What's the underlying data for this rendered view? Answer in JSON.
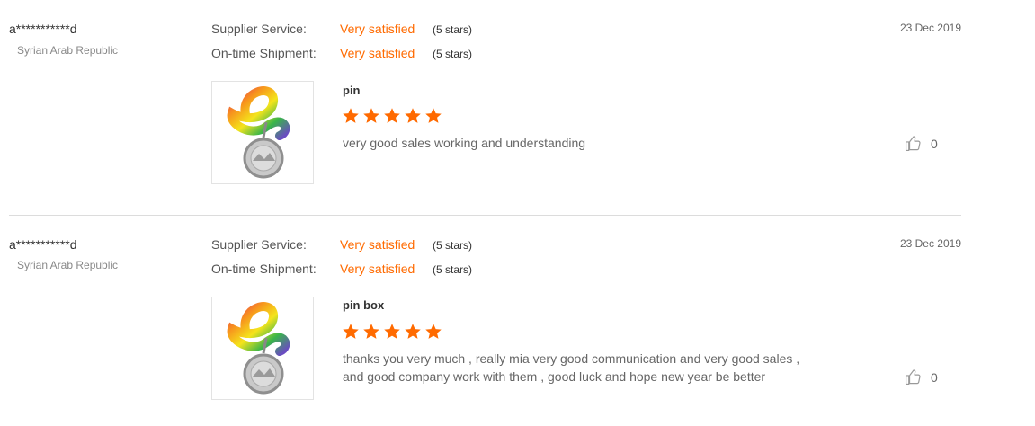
{
  "reviews": [
    {
      "buyer": "a***********d",
      "country": "Syrian Arab Republic",
      "supplier_service_label": "Supplier Service:",
      "supplier_service_value": "Very satisfied",
      "supplier_service_stars": "(5 stars)",
      "shipment_label": "On-time Shipment:",
      "shipment_value": "Very satisfied",
      "shipment_stars": "(5 stars)",
      "date": "23 Dec 2019",
      "product_name": "pin",
      "rating": 5,
      "comment": "very good sales working and understanding",
      "likes": "0"
    },
    {
      "buyer": "a***********d",
      "country": "Syrian Arab Republic",
      "supplier_service_label": "Supplier Service:",
      "supplier_service_value": "Very satisfied",
      "supplier_service_stars": "(5 stars)",
      "shipment_label": "On-time Shipment:",
      "shipment_value": "Very satisfied",
      "shipment_stars": "(5 stars)",
      "date": "23 Dec 2019",
      "product_name": "pin box",
      "rating": 5,
      "comment_line1": "thanks you very much , really mia very good communication and very good sales ,",
      "comment_line2": "and good company work with them , good luck and hope new year be better",
      "likes": "0"
    }
  ],
  "colors": {
    "accent": "#ff6a00",
    "star": "#ff6a00",
    "divider": "#dcdcdc"
  },
  "icons": {
    "like": "thumbs-up-icon",
    "star": "star-icon"
  }
}
